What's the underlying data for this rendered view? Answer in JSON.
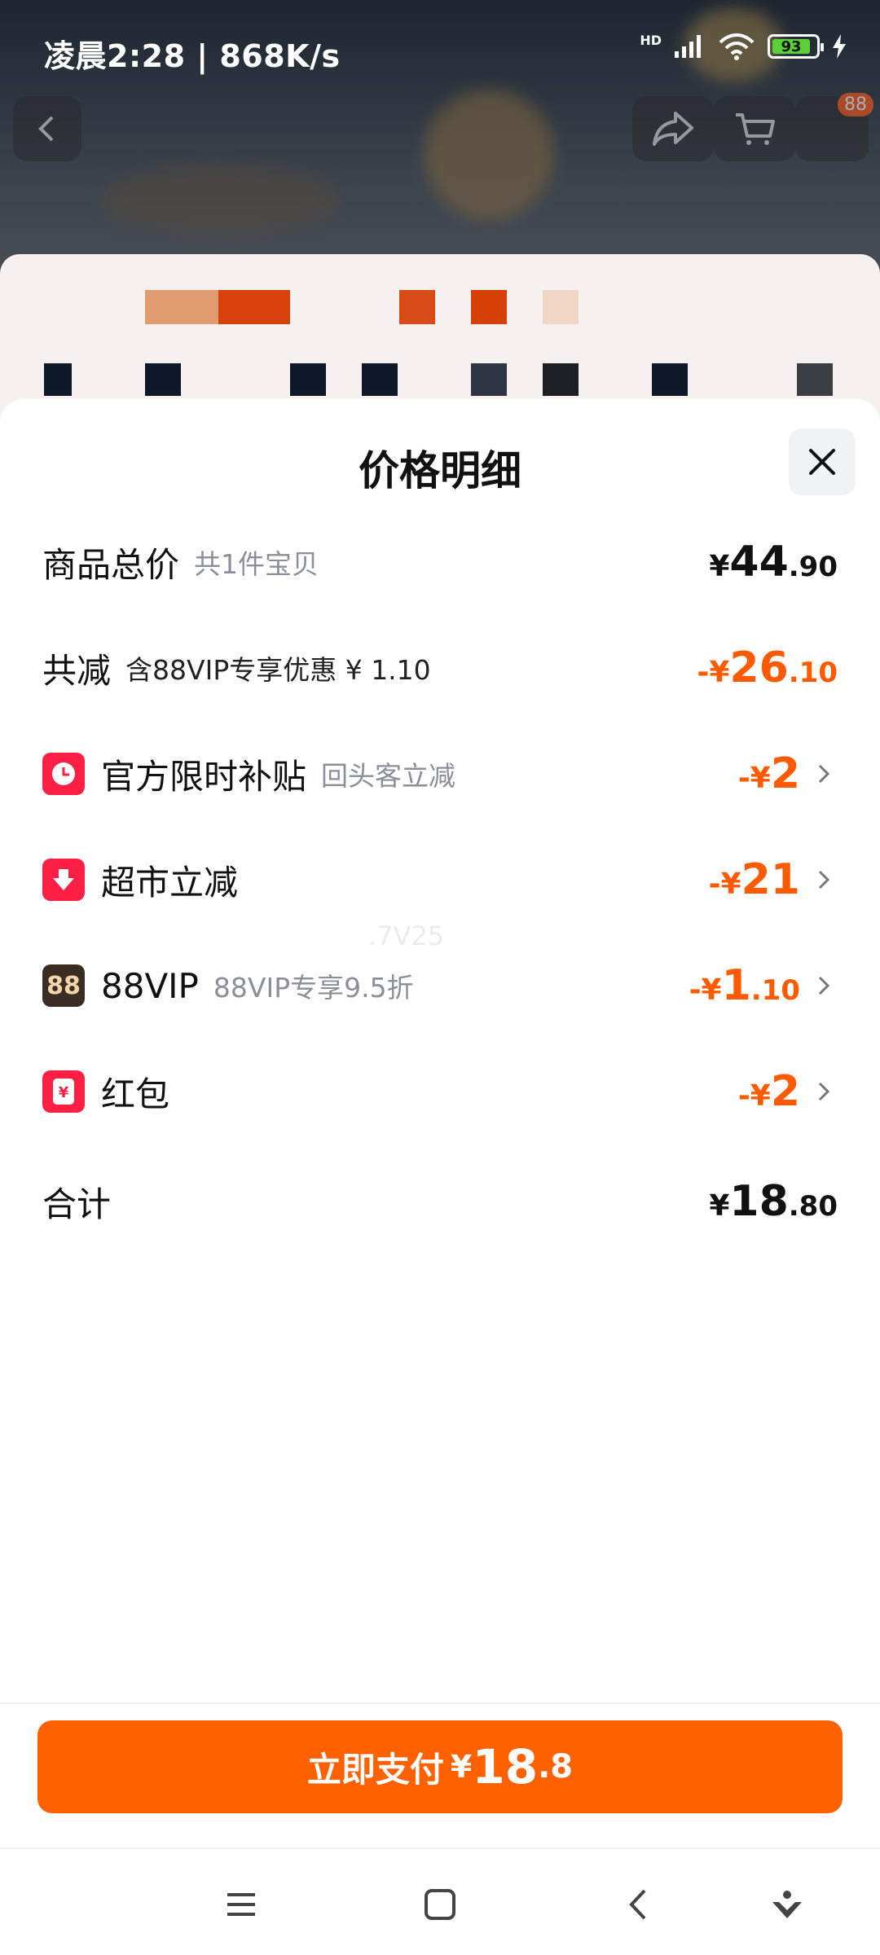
{
  "status_bar": {
    "time": "凌晨2:28 | 868K/s",
    "network": "HD",
    "battery": "93"
  },
  "background": {
    "cart_badge": "88"
  },
  "sheet": {
    "title": "价格明细",
    "rows": [
      {
        "label": "商品总价",
        "sub": "共1件宝贝",
        "amount": {
          "yen": "¥",
          "int": "44",
          "dec": ".90"
        },
        "color": "black"
      },
      {
        "label": "共减",
        "sub": "含88VIP专享优惠 ¥ 1.10",
        "amount": {
          "yen": "-¥",
          "int": "26",
          "dec": ".10"
        },
        "color": "orange"
      },
      {
        "label": "官方限时补贴",
        "sub": "回头客立减",
        "amount": {
          "yen": "-¥",
          "int": "2",
          "dec": ""
        },
        "icon": "clock-icon"
      },
      {
        "label": "超市立减",
        "sub": "",
        "amount": {
          "yen": "-¥",
          "int": "21",
          "dec": ""
        },
        "icon": "down-arrow-icon"
      },
      {
        "label": "88VIP",
        "sub": "88VIP专享9.5折",
        "amount": {
          "yen": "-¥",
          "int": "1",
          "dec": ".10"
        },
        "icon": "vip88-icon"
      },
      {
        "label": "红包",
        "sub": "",
        "amount": {
          "yen": "-¥",
          "int": "2",
          "dec": ""
        },
        "icon": "red-packet-icon"
      },
      {
        "label": "合计",
        "sub": "",
        "amount": {
          "yen": "¥",
          "int": "18",
          "dec": ".80"
        },
        "color": "black"
      }
    ],
    "watermark": ".7V25"
  },
  "pay_button": {
    "label": "立即支付",
    "yen": "¥",
    "int": "18",
    "dec": ".8"
  },
  "colors": {
    "accent": "#ff6000",
    "discount": "#ff5a00",
    "icon_red": "#ff1f44",
    "vip_bg": "#3a2e24"
  }
}
